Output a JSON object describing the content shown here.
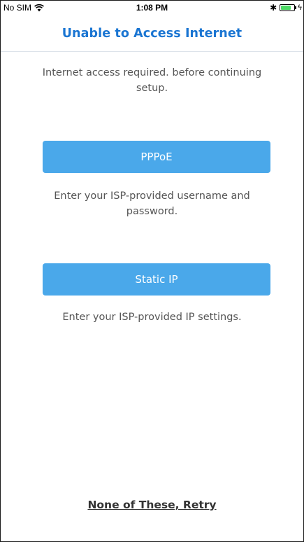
{
  "status_bar": {
    "carrier": "No SIM",
    "time": "1:08 PM",
    "bluetooth_glyph": "✱",
    "charge_glyph": "ϟ",
    "battery_level": 0.75,
    "battery_color": "#4cd964"
  },
  "header": {
    "title": "Unable to Access Internet"
  },
  "intro_text": "Internet access required. before continuing setup.",
  "options": [
    {
      "button_label": "PPPoE",
      "description": "Enter your ISP-provided username and password."
    },
    {
      "button_label": "Static IP",
      "description": "Enter your ISP-provided IP settings."
    }
  ],
  "retry_label": "None of These, Retry",
  "colors": {
    "title": "#1a75d2",
    "button": "#4aa8ea",
    "button_text": "#ffffff",
    "body_text": "#555555"
  },
  "icons": [
    "wifi-icon",
    "bluetooth-icon",
    "battery-icon",
    "charging-icon"
  ]
}
